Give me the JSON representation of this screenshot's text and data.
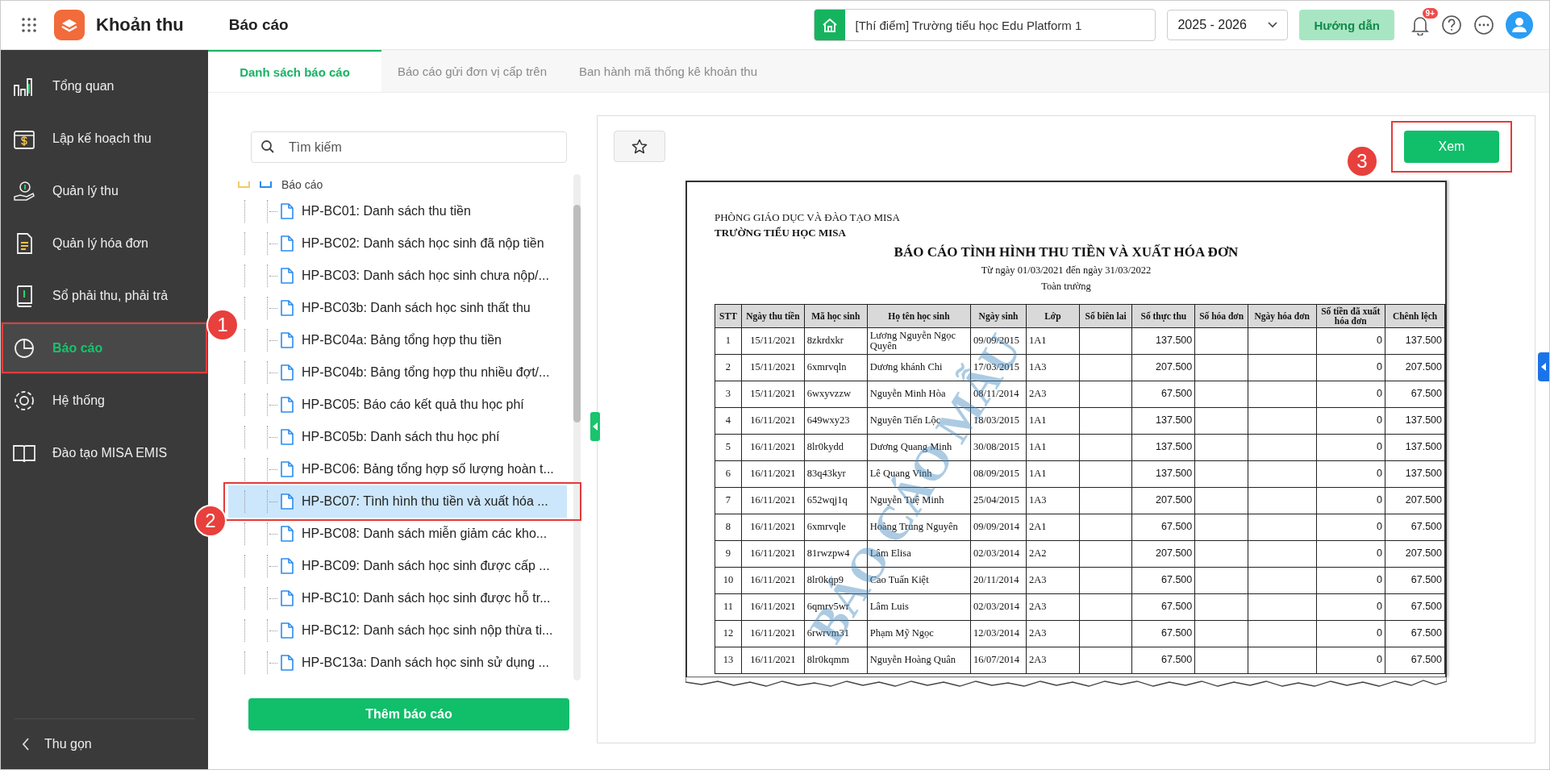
{
  "app": {
    "name": "Khoản thu",
    "page_title": "Báo cáo"
  },
  "header": {
    "school": "[Thí điểm] Trường tiểu học Edu Platform 1",
    "year": "2025 - 2026",
    "guide_button": "Hướng dẫn",
    "notification_badge": "9+"
  },
  "sidebar": {
    "items": [
      {
        "label": "Tổng quan",
        "selected": false
      },
      {
        "label": "Lập kế hoạch thu",
        "selected": false
      },
      {
        "label": "Quản lý thu",
        "selected": false
      },
      {
        "label": "Quản lý hóa đơn",
        "selected": false
      },
      {
        "label": "Sổ phải thu, phải trả",
        "selected": false
      },
      {
        "label": "Báo cáo",
        "selected": true
      },
      {
        "label": "Hệ thống",
        "selected": false
      },
      {
        "label": "Đào tạo MISA EMIS",
        "selected": false
      }
    ],
    "collapse": "Thu gọn"
  },
  "tabs": [
    {
      "label": "Danh sách báo cáo",
      "selected": true
    },
    {
      "label": "Báo cáo gửi đơn vị cấp trên",
      "selected": false
    },
    {
      "label": "Ban hành mã thống kê khoản thu",
      "selected": false
    }
  ],
  "report_tree": {
    "search_placeholder": "Tìm kiếm",
    "root": "Báo cáo",
    "items": [
      {
        "label": "HP-BC01: Danh sách thu tiền",
        "selected": false
      },
      {
        "label": "HP-BC02: Danh sách học sinh đã nộp tiền",
        "selected": false
      },
      {
        "label": "HP-BC03: Danh sách học sinh chưa nộp/...",
        "selected": false
      },
      {
        "label": "HP-BC03b: Danh sách học sinh thất thu",
        "selected": false
      },
      {
        "label": "HP-BC04a: Bảng tổng hợp thu tiền",
        "selected": false
      },
      {
        "label": "HP-BC04b: Bảng tổng hợp thu nhiều đợt/...",
        "selected": false
      },
      {
        "label": "HP-BC05: Báo cáo kết quả thu học phí",
        "selected": false
      },
      {
        "label": "HP-BC05b: Danh sách thu học phí",
        "selected": false
      },
      {
        "label": "HP-BC06: Bảng tổng hợp số lượng hoàn t...",
        "selected": false
      },
      {
        "label": "HP-BC07: Tình hình thu tiền và xuất hóa ...",
        "selected": true
      },
      {
        "label": "HP-BC08: Danh sách miễn giảm các kho...",
        "selected": false
      },
      {
        "label": "HP-BC09: Danh sách học sinh được cấp ...",
        "selected": false
      },
      {
        "label": "HP-BC10: Danh sách học sinh được hỗ tr...",
        "selected": false
      },
      {
        "label": "HP-BC12: Danh sách học sinh nộp thừa ti...",
        "selected": false
      },
      {
        "label": "HP-BC13a: Danh sách học sinh sử dụng ...",
        "selected": false
      }
    ],
    "add_button": "Thêm báo cáo"
  },
  "preview": {
    "view_button": "Xem",
    "report": {
      "department": "PHÒNG GIÁO DỤC VÀ ĐÀO TẠO MISA",
      "school": "TRƯỜNG TIỂU HỌC MISA",
      "title": "BÁO CÁO TÌNH HÌNH THU TIỀN VÀ XUẤT HÓA ĐƠN",
      "period": "Từ ngày 01/03/2021 đến ngày 31/03/2022",
      "scope": "Toàn trường",
      "watermark": "BÁO CÁO MẪU",
      "columns": [
        "STT",
        "Ngày thu tiền",
        "Mã học sinh",
        "Họ tên học sinh",
        "Ngày sinh",
        "Lớp",
        "Số biên lai",
        "Số thực thu",
        "Số hóa đơn",
        "Ngày hóa đơn",
        "Số tiền đã xuất hóa đơn",
        "Chênh lệch"
      ],
      "rows": [
        [
          "1",
          "15/11/2021",
          "8zkrdxkr",
          "Lương Nguyễn Ngọc Quyên",
          "09/09/2015",
          "1A1",
          "",
          "137.500",
          "",
          "",
          "0",
          "137.500"
        ],
        [
          "2",
          "15/11/2021",
          "6xmrvqln",
          "Dương khánh Chi",
          "17/03/2015",
          "1A3",
          "",
          "207.500",
          "",
          "",
          "0",
          "207.500"
        ],
        [
          "3",
          "15/11/2021",
          "6wxyvzzw",
          "Nguyễn Minh Hòa",
          "08/11/2014",
          "2A3",
          "",
          "67.500",
          "",
          "",
          "0",
          "67.500"
        ],
        [
          "4",
          "16/11/2021",
          "649wxy23",
          "Nguyên Tiến Lộc",
          "18/03/2015",
          "1A1",
          "",
          "137.500",
          "",
          "",
          "0",
          "137.500"
        ],
        [
          "5",
          "16/11/2021",
          "8lr0kydd",
          "Dương Quang Minh",
          "30/08/2015",
          "1A1",
          "",
          "137.500",
          "",
          "",
          "0",
          "137.500"
        ],
        [
          "6",
          "16/11/2021",
          "83q43kyr",
          "Lê Quang Vinh",
          "08/09/2015",
          "1A1",
          "",
          "137.500",
          "",
          "",
          "0",
          "137.500"
        ],
        [
          "7",
          "16/11/2021",
          "652wqj1q",
          "Nguyễn Tuệ Minh",
          "25/04/2015",
          "1A3",
          "",
          "207.500",
          "",
          "",
          "0",
          "207.500"
        ],
        [
          "8",
          "16/11/2021",
          "6xmrvqle",
          "Hoàng Trung Nguyên",
          "09/09/2014",
          "2A1",
          "",
          "67.500",
          "",
          "",
          "0",
          "67.500"
        ],
        [
          "9",
          "16/11/2021",
          "81rwzpw4",
          "Lâm Elisa",
          "02/03/2014",
          "2A2",
          "",
          "207.500",
          "",
          "",
          "0",
          "207.500"
        ],
        [
          "10",
          "16/11/2021",
          "8lr0kqp9",
          "Cao Tuấn Kiệt",
          "20/11/2014",
          "2A3",
          "",
          "67.500",
          "",
          "",
          "0",
          "67.500"
        ],
        [
          "11",
          "16/11/2021",
          "6qmrv5wr",
          "Lâm Luis",
          "02/03/2014",
          "2A3",
          "",
          "67.500",
          "",
          "",
          "0",
          "67.500"
        ],
        [
          "12",
          "16/11/2021",
          "6rwrvm31",
          "Phạm Mỹ Ngọc",
          "12/03/2014",
          "2A3",
          "",
          "67.500",
          "",
          "",
          "0",
          "67.500"
        ],
        [
          "13",
          "16/11/2021",
          "8lr0kqmm",
          "Nguyễn Hoàng Quân",
          "16/07/2014",
          "2A3",
          "",
          "67.500",
          "",
          "",
          "0",
          "67.500"
        ]
      ]
    }
  },
  "step_markers": {
    "sidebar": "1",
    "tree": "2",
    "view": "3"
  }
}
